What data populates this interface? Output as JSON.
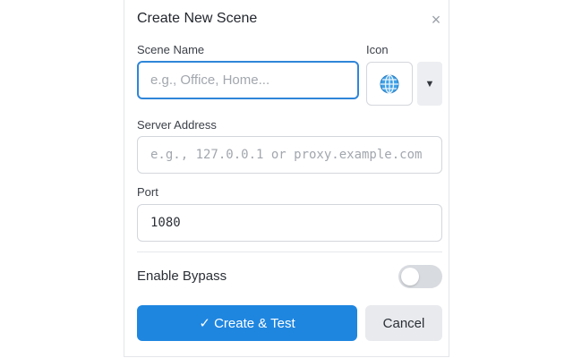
{
  "dialog": {
    "title": "Create New Scene",
    "close_label": "×",
    "close_icon": "close-icon"
  },
  "scene_name": {
    "label": "Scene Name",
    "placeholder": "e.g., Office, Home...",
    "value": ""
  },
  "icon": {
    "label": "Icon",
    "selected": "globe-icon",
    "dropdown_glyph": "▼"
  },
  "server_address": {
    "label": "Server Address",
    "placeholder": "e.g., 127.0.0.1 or proxy.example.com",
    "value": ""
  },
  "port": {
    "label": "Port",
    "value": "1080"
  },
  "bypass": {
    "label": "Enable Bypass",
    "enabled": false
  },
  "actions": {
    "create_label": "✓ Create & Test",
    "cancel_label": "Cancel"
  },
  "colors": {
    "accent": "#1f86e0",
    "focus_border": "#2f86d9",
    "secondary_bg": "#e8eaed",
    "toggle_off": "#d8dbe0"
  }
}
